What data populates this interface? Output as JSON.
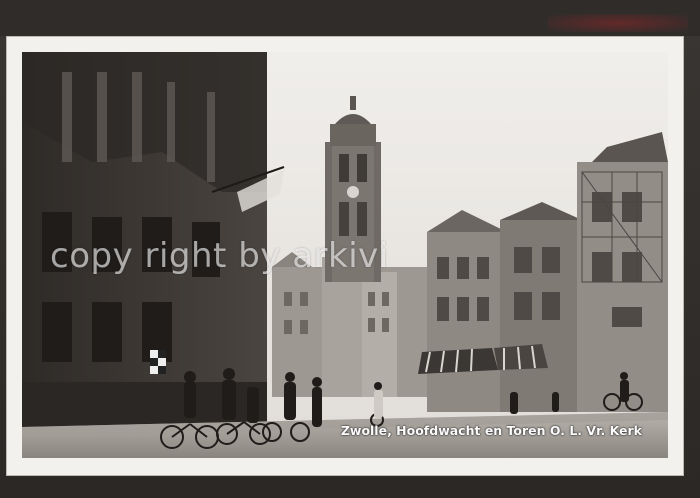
{
  "postcard": {
    "caption": "Zwolle, Hoofdwacht en Toren O. L. Vr. Kerk",
    "watermark": "copy right by arkivi"
  },
  "colors": {
    "frame": "#2a2826",
    "card": "#f3f1ee",
    "sky": "#e9e6e2",
    "dark_building": "#3b3734"
  },
  "scene": {
    "subject": "street scene with church tower",
    "elements": [
      "left-building",
      "church-tower",
      "shops-right",
      "cyclists",
      "street"
    ]
  }
}
